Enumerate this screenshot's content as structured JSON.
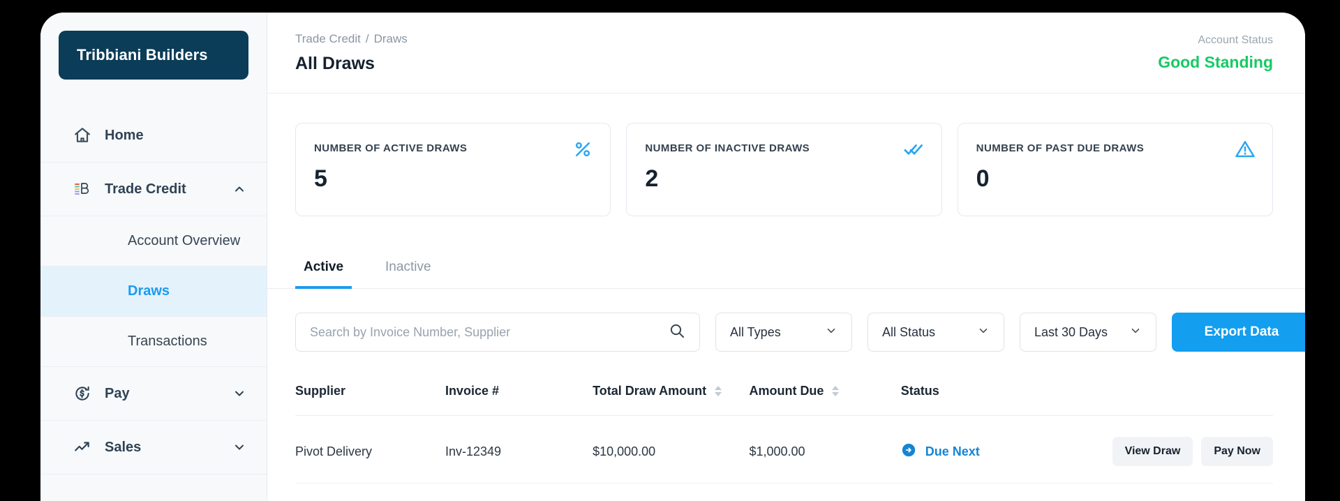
{
  "sidebar": {
    "brand": "Tribbiani Builders",
    "items": [
      {
        "label": "Home",
        "icon": "home-icon",
        "expandable": false
      },
      {
        "label": "Trade Credit",
        "icon": "trade-credit-icon",
        "expandable": true,
        "expanded": true,
        "chevron": "chevron-up-icon"
      },
      {
        "label": "Pay",
        "icon": "pay-dollar-icon",
        "expandable": true,
        "expanded": false,
        "chevron": "chevron-down-icon"
      },
      {
        "label": "Sales",
        "icon": "trending-up-icon",
        "expandable": true,
        "expanded": false,
        "chevron": "chevron-down-icon"
      }
    ],
    "trade_credit_children": [
      {
        "label": "Account Overview",
        "active": false
      },
      {
        "label": "Draws",
        "active": true
      },
      {
        "label": "Transactions",
        "active": false
      }
    ]
  },
  "header": {
    "breadcrumb": {
      "parent": "Trade Credit",
      "separator": "/",
      "current": "Draws"
    },
    "title": "All Draws",
    "account_status_label": "Account Status",
    "account_status_value": "Good Standing",
    "account_status_color": "#18c964"
  },
  "cards": [
    {
      "label": "NUMBER OF ACTIVE DRAWS",
      "value": "5",
      "icon": "percent-icon"
    },
    {
      "label": "NUMBER OF INACTIVE DRAWS",
      "value": "2",
      "icon": "double-check-icon"
    },
    {
      "label": "NUMBER OF PAST DUE DRAWS",
      "value": "0",
      "icon": "warning-triangle-icon"
    }
  ],
  "tabs": [
    {
      "label": "Active",
      "active": true
    },
    {
      "label": "Inactive",
      "active": false
    }
  ],
  "toolbar": {
    "search_placeholder": "Search by Invoice Number, Supplier",
    "search_value": "",
    "search_icon": "search-icon",
    "filters": [
      {
        "name": "types",
        "value": "All Types"
      },
      {
        "name": "status",
        "value": "All Status"
      },
      {
        "name": "range",
        "value": "Last 30 Days"
      }
    ],
    "export_label": "Export Data",
    "export_color": "#139ef0"
  },
  "table": {
    "columns": [
      {
        "label": "Supplier",
        "sortable": false
      },
      {
        "label": "Invoice #",
        "sortable": false
      },
      {
        "label": "Total Draw Amount",
        "sortable": true
      },
      {
        "label": "Amount Due",
        "sortable": true
      },
      {
        "label": "Status",
        "sortable": false
      },
      {
        "label": "",
        "sortable": false
      }
    ],
    "rows": [
      {
        "supplier": "Pivot Delivery",
        "invoice": "Inv-12349",
        "total_draw_amount": "$10,000.00",
        "amount_due": "$1,000.00",
        "status": "Due Next",
        "status_icon": "arrow-right-circle-icon",
        "status_color": "#1585d3",
        "actions": [
          "View Draw",
          "Pay Now"
        ]
      }
    ]
  },
  "accent": {
    "blue": "#139ef0",
    "navy": "#0b3c58",
    "active_bg": "#e4f2fc"
  }
}
